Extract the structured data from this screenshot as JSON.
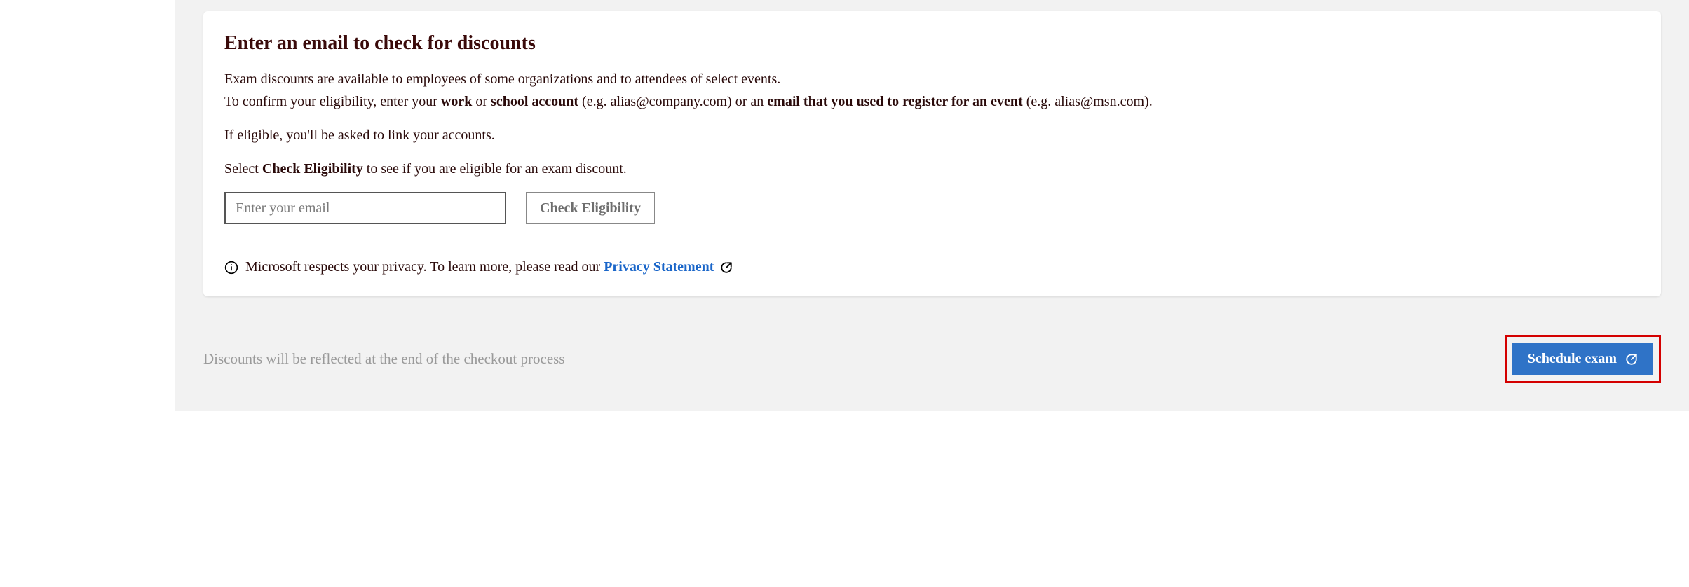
{
  "card": {
    "title": "Enter an email to check for discounts",
    "line1": "Exam discounts are available to employees of some organizations and to attendees of select events.",
    "line2_pre": "To confirm your eligibility, enter your ",
    "line2_bold1": "work",
    "line2_mid1": " or ",
    "line2_bold2": "school account",
    "line2_mid2": " (e.g. alias@company.com) or an ",
    "line2_bold3": "email that you used to register for an event",
    "line2_post": " (e.g. alias@msn.com).",
    "line3": "If eligible, you'll be asked to link your accounts.",
    "line4_pre": "Select ",
    "line4_bold": "Check Eligibility",
    "line4_post": " to see if you are eligible for an exam discount.",
    "email_placeholder": "Enter your email",
    "check_btn": "Check Eligibility",
    "privacy_pre": "Microsoft respects your privacy. To learn more, please read our ",
    "privacy_link": "Privacy Statement"
  },
  "footer": {
    "note": "Discounts will be reflected at the end of the checkout process",
    "schedule_btn": "Schedule exam"
  }
}
